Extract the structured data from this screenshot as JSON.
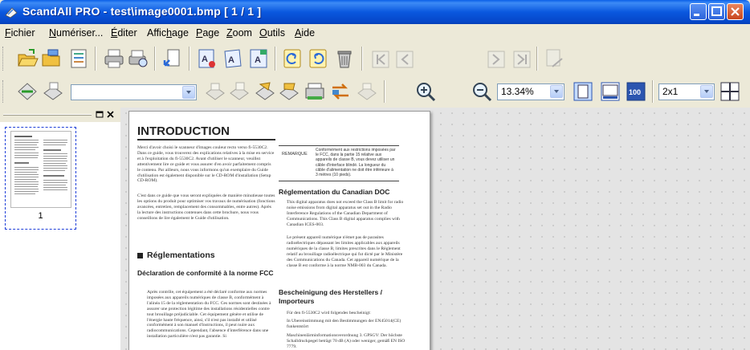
{
  "window": {
    "title": "ScandAll PRO - test\\image0001.bmp  [ 1 / 1 ]",
    "colors": {
      "titlebar": "#0a58df",
      "accent": "#1f3fd8",
      "viewer_bg": "#e4e4e4"
    }
  },
  "menu": [
    {
      "pre": "",
      "u": "F",
      "post": "ichier"
    },
    {
      "pre": "",
      "u": "N",
      "post": "umériser..."
    },
    {
      "pre": "",
      "u": "É",
      "post": "diter"
    },
    {
      "pre": "Affic",
      "u": "h",
      "post": "age"
    },
    {
      "pre": "",
      "u": "P",
      "post": "age"
    },
    {
      "pre": "",
      "u": "Z",
      "post": "oom"
    },
    {
      "pre": "",
      "u": "O",
      "post": "utils"
    },
    {
      "pre": "",
      "u": "A",
      "post": "ide"
    }
  ],
  "toolbar1": {
    "icons": [
      "open-folder-icon",
      "scan-folder-icon",
      "properties-icon",
      "print-icon",
      "print-preview-icon",
      "import-icon",
      "ocr-icon",
      "edit-text-icon",
      "text-area-icon",
      "rotate-left-icon",
      "rotate-right-icon",
      "delete-icon",
      "first-page-icon",
      "prev-page-icon",
      "next-page-icon",
      "last-page-icon",
      "go-to-page-icon"
    ],
    "page_number": "1"
  },
  "toolbar2": {
    "icons": [
      "scan-green-icon",
      "scan-profile-icon",
      "scan-batch-icon",
      "scan-sheet-icon",
      "scan-copy-icon",
      "scan-file-icon",
      "scan-merge-icon",
      "scan-swap-icon",
      "scan-disabled-icon",
      "zoom-in-icon",
      "zoom-out-icon",
      "fit-page-icon",
      "fit-width-icon",
      "actual-size-icon",
      "grid-view-icon"
    ],
    "profile_value": "",
    "zoom_value": "13.34%",
    "layout_value": "2x1"
  },
  "thumbnails": {
    "items": [
      {
        "number": "1"
      }
    ]
  },
  "document": {
    "heading": "INTRODUCTION",
    "intro_paragraph": "Merci d'avoir choisi le scanneur d'images couleur recto verso fi-5530C2. Dans ce guide, vous trouverez des explications relatives à la mise en service et à l'exploitation du fi-5530C2. Avant d'utiliser le scanneur, veuillez attentivement lire ce guide et vous assurer d'en avoir parfaitement compris le contenu. Par ailleurs, nous vous informons qu'un exemplaire du Guide d'utilisation est également disponible sur le CD-ROM d'installation (Setup CD-ROM).",
    "intro_paragraph2": "C'est dans ce guide que vous seront expliquées de manière minutieuse toutes les options du produit pour optimiser vos travaux de numérisation (fonctions avancées, entretien, remplacement des consommables, entre autres). Après la lecture des instructions contenues dans cette brochure, nous vous conseillons de lire également le Guide d'utilisation.",
    "section_regulations": "Réglementations",
    "fcc_heading": "Déclaration de conformité à la norme FCC",
    "fcc_text": "Après contrôle, cet équipement a été déclaré conforme aux normes imposées aux appareils numériques de classe B, conformément à l'alinéa 15 de la réglementation du FCC. Ces normes sont destinées à assurer une protection légitime des installations résidentielles contre tout brouillage préjudiciable. Cet équipement génère et utilise de l'énergie haute fréquence, ainsi, s'il n'est pas installé et utilisé conformément à son manuel d'instructions, il peut nuire aux radiocommunications. Cependant, l'absence d'interférence dans une installation particulière n'est pas garantie. Si",
    "remark_label": "REMARQUE",
    "remark_text": "Conformément aux restrictions imposées par le FCC, dans la partie 15 relative aux appareils de classe B, vous devez utiliser un câble d'interface blindé. La longueur du câble d'alimentation ne doit être inférieure à 3 mètres (10 pieds).",
    "canada_heading": "Réglementation du Canadian DOC",
    "canada_text": "This digital apparatus does not exceed the Class B limit for radio noise emissions from digital apparatus set out in the Radio Interference Regulations of the Canadian Department of Communications. This Class B digital apparatus complies with Canadian ICES-003.",
    "canada_text_fr": "Le présent appareil numérique n'émet pas de parasites radioélectriques dépassant les limites applicables aux appareils numériques de la classe B, limites prescrites dans le Règlement relatif au brouillage radioélectrique qui fut dicté par le Ministère des Communications du Canada. Cet appareil numérique de la classe B est conforme à la norme NMB-003 du Canada.",
    "german_heading": "Bescheinigung des Herstellers / Importeurs",
    "german_text": "Für den fi-5530C2 wird folgendes bescheinigt:",
    "german_b1": "In Übereinstimmung mit den Bestimmungen der EN45014(CE) funkentstört",
    "german_b2": "Maschinenlärminformationsverordnung 3. GPSGV: Der höchste Schalldruckpegel beträgt 70 dB (A) oder weniger, gemäß EN ISO 7779."
  }
}
